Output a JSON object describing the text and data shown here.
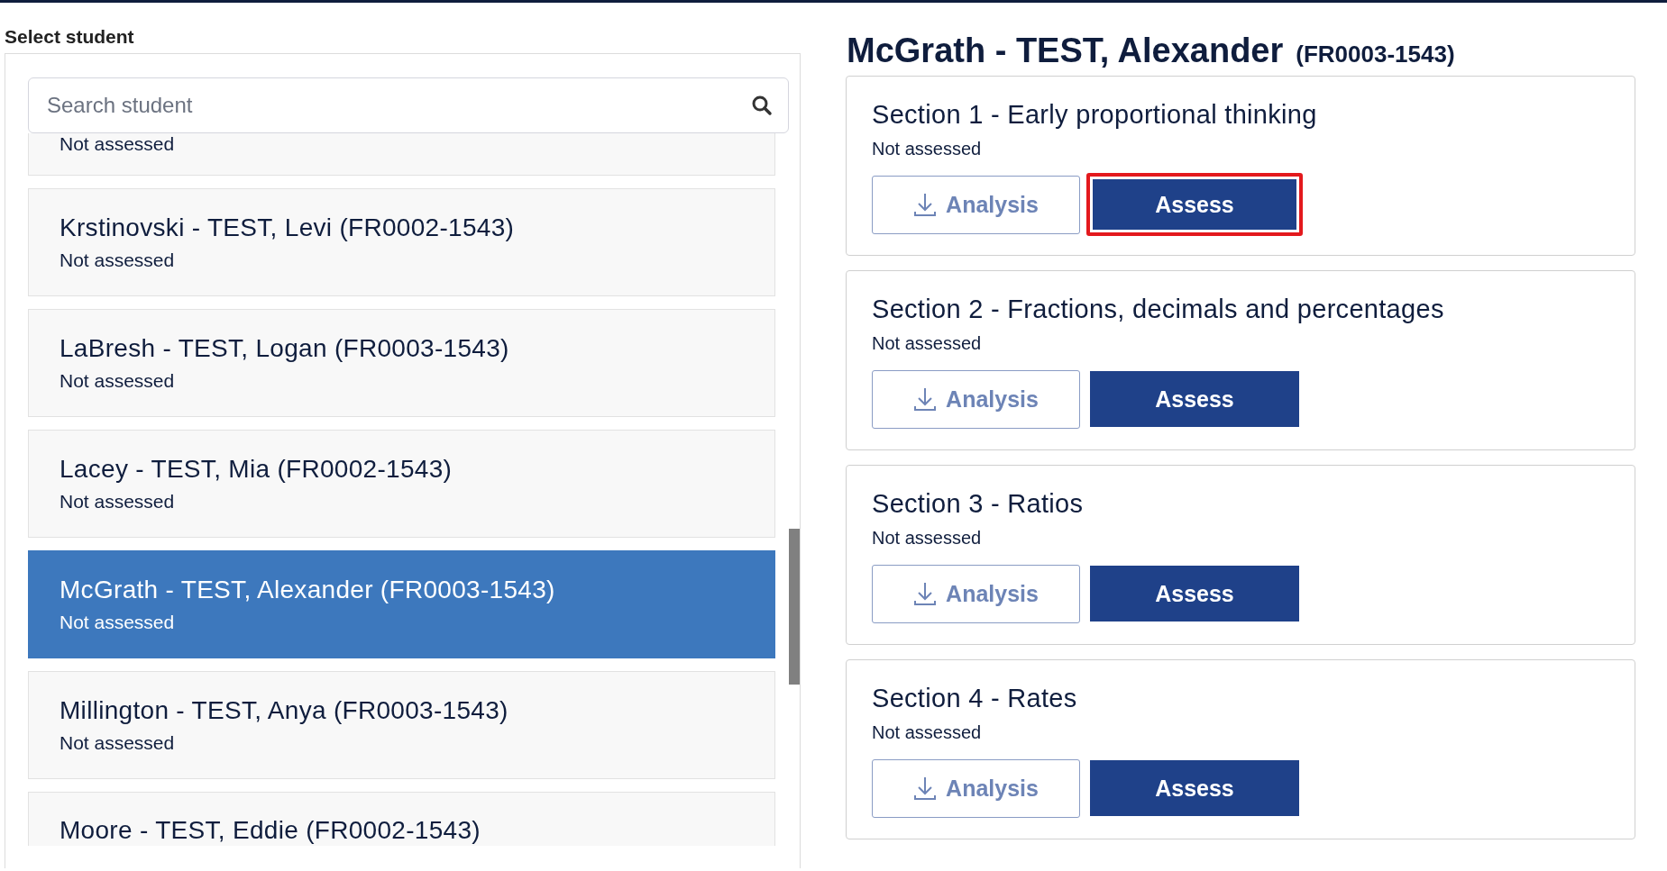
{
  "student_panel": {
    "label": "Select student",
    "search": {
      "placeholder": "Search student"
    },
    "students": [
      {
        "kind": "partial",
        "status": "Not assessed",
        "selected": false
      },
      {
        "kind": "full",
        "name": "Krstinovski - TEST, Levi (FR0002-1543)",
        "status": "Not assessed",
        "selected": false
      },
      {
        "kind": "full",
        "name": "LaBresh - TEST, Logan (FR0003-1543)",
        "status": "Not assessed",
        "selected": false
      },
      {
        "kind": "full",
        "name": "Lacey - TEST, Mia (FR0002-1543)",
        "status": "Not assessed",
        "selected": false
      },
      {
        "kind": "full",
        "name": "McGrath - TEST, Alexander (FR0003-1543)",
        "status": "Not assessed",
        "selected": true
      },
      {
        "kind": "full",
        "name": "Millington - TEST, Anya (FR0003-1543)",
        "status": "Not assessed",
        "selected": false
      },
      {
        "kind": "full",
        "name": "Moore - TEST, Eddie (FR0002-1543)",
        "selected": false
      }
    ]
  },
  "detail": {
    "name": "McGrath - TEST, Alexander",
    "code": "(FR0003-1543)",
    "sections": [
      {
        "title": "Section 1 - Early proportional thinking",
        "status": "Not assessed",
        "analysis": "Analysis",
        "assess": "Assess",
        "highlighted": true
      },
      {
        "title": "Section 2 - Fractions, decimals and percentages",
        "status": "Not assessed",
        "analysis": "Analysis",
        "assess": "Assess",
        "highlighted": false
      },
      {
        "title": "Section 3 - Ratios",
        "status": "Not assessed",
        "analysis": "Analysis",
        "assess": "Assess",
        "highlighted": false
      },
      {
        "title": "Section 4 - Rates",
        "status": "Not assessed",
        "analysis": "Analysis",
        "assess": "Assess",
        "highlighted": false
      }
    ]
  }
}
